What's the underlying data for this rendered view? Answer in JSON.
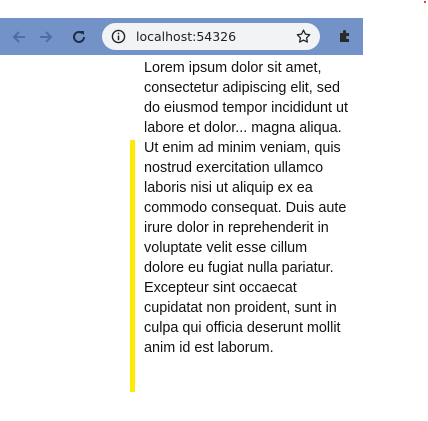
{
  "browser": {
    "url": "localhost:54326",
    "icons": {
      "back": "arrow-left-icon",
      "forward": "arrow-right-icon",
      "reload": "reload-icon",
      "site_info": "info-icon",
      "bookmark": "star-icon",
      "extension": "puzzle-icon"
    },
    "colors": {
      "toolbar": "#7393c8",
      "omnibox": "#f1f3f4"
    }
  },
  "page": {
    "body_text": "Lorem ipsum dolor sit amet, consectetur adipiscing elit, sed do eiusmod tempor incididunt ut labore et dolor... magna aliqua. Ut enim ad minim veniam, quis nostrud exercitation ullamco laboris nisi ut aliquip ex ea commodo consequat. Duis aute irure dolor in reprehenderit in voluptate velit esse cillum dolore eu fugiat nulla pariatur. Excepteur sint occaecat cupidatat non proident, sunt in culpa qui officia deserunt mollit anim id est laborum.",
    "colors": {
      "accent_bar": "#ffeb00"
    }
  }
}
